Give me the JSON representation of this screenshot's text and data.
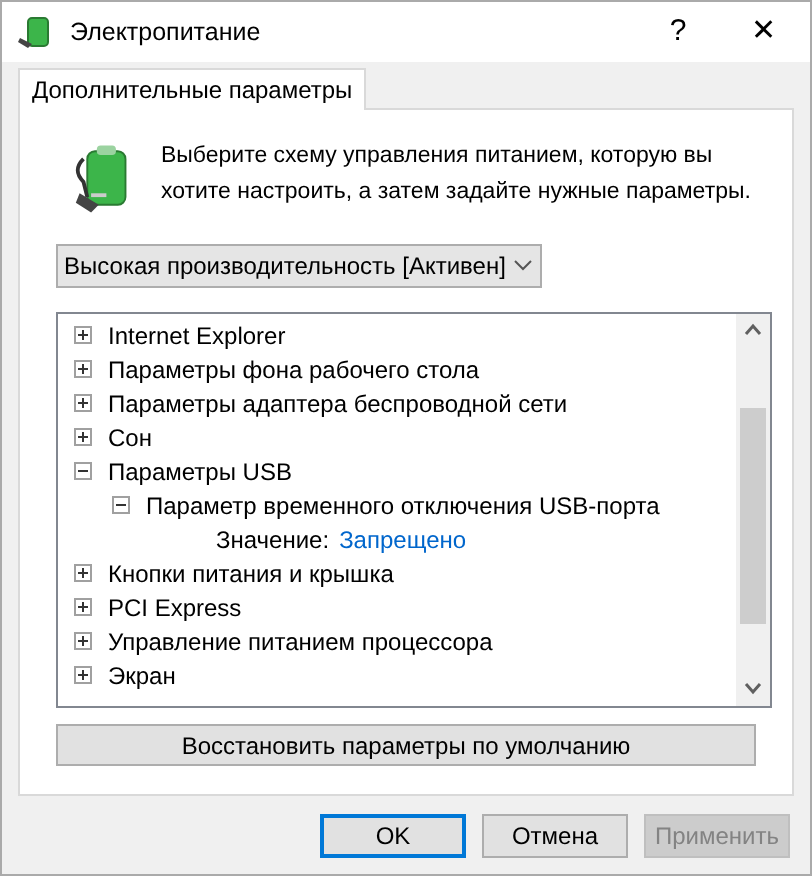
{
  "window": {
    "title": "Электропитание",
    "help": "?",
    "close": "✕"
  },
  "tabs": [
    {
      "label": "Дополнительные параметры",
      "selected": true
    }
  ],
  "intro": "Выберите схему управления питанием, которую вы хотите настроить, а затем задайте нужные параметры.",
  "plan_select": {
    "value": "Высокая производительность [Активен]"
  },
  "tree": [
    {
      "label": "Internet Explorer",
      "expanded": false
    },
    {
      "label": "Параметры фона рабочего стола",
      "expanded": false
    },
    {
      "label": "Параметры адаптера беспроводной сети",
      "expanded": false
    },
    {
      "label": "Сон",
      "expanded": false
    },
    {
      "label": "Параметры USB",
      "expanded": true,
      "children": [
        {
          "label": "Параметр временного отключения USB-порта",
          "expanded": true,
          "setting": {
            "label": "Значение:",
            "value": "Запрещено"
          }
        }
      ]
    },
    {
      "label": "Кнопки питания и крышка",
      "expanded": false
    },
    {
      "label": "PCI Express",
      "expanded": false
    },
    {
      "label": "Управление питанием процессора",
      "expanded": false
    },
    {
      "label": "Экран",
      "expanded": false
    }
  ],
  "restore_button": "Восстановить параметры по умолчанию",
  "buttons": [
    {
      "label": "OK",
      "disabled": false,
      "default": true
    },
    {
      "label": "Отмена",
      "disabled": false,
      "default": false
    },
    {
      "label": "Применить",
      "disabled": true,
      "default": false
    }
  ]
}
